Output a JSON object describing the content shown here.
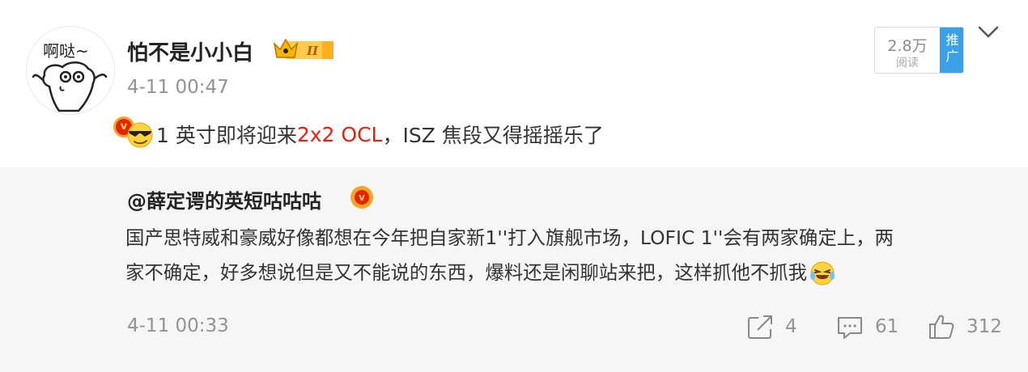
{
  "post": {
    "avatar_text": "啊哒~",
    "username": "怕不是小小白",
    "level_label": "II",
    "timestamp": "4-11 00:47",
    "read_count": "2.8万",
    "read_label": "阅读",
    "promote_label_1": "推",
    "promote_label_2": "广",
    "text_part1": "1 英寸即将迎来 ",
    "text_highlight": "2x2 OCL",
    "text_part2": "，ISZ 焦段又得摇摇乐了",
    "emoji": "cool-sunglasses-emoji",
    "accent_color": "#e8210b"
  },
  "repost": {
    "username": "@薛定谔的英短咕咕咕",
    "line1": "国产思特威和豪威好像都想在今年把自家新1''打入旗舰市场，LOFIC 1''会有两家确定上，两",
    "line2": "家不确定，好多想说但是又不能说的东西，爆料还是闲聊站来把，这样抓他不抓我",
    "emoji": "laugh-cry-emoji",
    "timestamp": "4-11 00:33",
    "share_count": "4",
    "comment_count": "61",
    "like_count": "312"
  }
}
